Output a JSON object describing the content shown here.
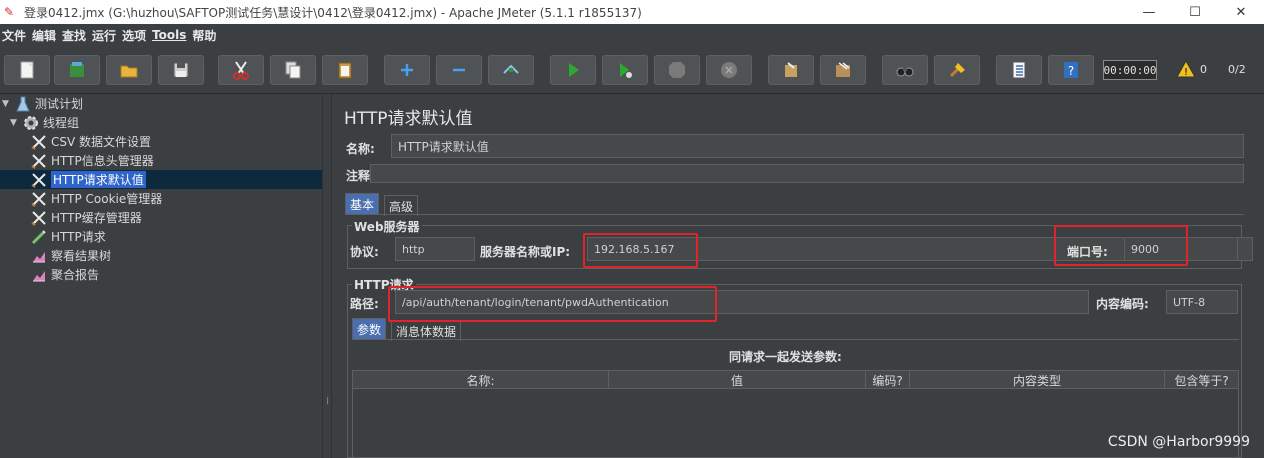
{
  "window": {
    "title": "登录0412.jmx (G:\\huzhou\\SAFTOP测试任务\\慧设计\\0412\\登录0412.jmx) - Apache JMeter (5.1.1 r1855137)",
    "minimize": "—",
    "maximize": "☐",
    "close": "✕"
  },
  "menu": [
    "文件",
    "编辑",
    "查找",
    "运行",
    "选项",
    "Tools",
    "帮助"
  ],
  "toolbar": {
    "timer": "00:00:00",
    "warning_count": "0",
    "threads": "0/2",
    "icons": [
      "new-icon",
      "templates-icon",
      "open-icon",
      "save-icon",
      "cut-icon",
      "copy-icon",
      "paste-icon",
      "expand-icon",
      "collapse-icon",
      "toggle-icon",
      "start-icon",
      "start-no-pause-icon",
      "stop-icon",
      "shutdown-icon",
      "clear-icon",
      "clear-all-icon",
      "search-icon",
      "reset-search-icon",
      "function-helper-icon",
      "help-icon"
    ]
  },
  "tree": [
    {
      "label": "测试计划",
      "icon": "test-plan-icon"
    },
    {
      "label": "线程组",
      "icon": "thread-group-icon"
    },
    {
      "label": "CSV 数据文件设置",
      "icon": "config-icon"
    },
    {
      "label": "HTTP信息头管理器",
      "icon": "config-icon"
    },
    {
      "label": "HTTP请求默认值",
      "icon": "config-icon"
    },
    {
      "label": "HTTP Cookie管理器",
      "icon": "config-icon"
    },
    {
      "label": "HTTP缓存管理器",
      "icon": "config-icon"
    },
    {
      "label": "HTTP请求",
      "icon": "sampler-icon"
    },
    {
      "label": "察看结果树",
      "icon": "listener-icon"
    },
    {
      "label": "聚合报告",
      "icon": "listener-icon"
    }
  ],
  "panel": {
    "title": "HTTP请求默认值",
    "name_label": "名称:",
    "name_value": "HTTP请求默认值",
    "comment_label": "注释:",
    "comment_value": "",
    "tabs": [
      "基本",
      "高级"
    ],
    "web_server": {
      "group_title": "Web服务器",
      "protocol_label": "协议:",
      "protocol_value": "http",
      "server_label": "服务器名称或IP:",
      "server_value": "192.168.5.167",
      "port_label": "端口号:",
      "port_value": "9000"
    },
    "http_request": {
      "group_title": "HTTP请求",
      "path_label": "路径:",
      "path_value": "/api/auth/tenant/login/tenant/pwdAuthentication",
      "encoding_label": "内容编码:",
      "encoding_value": "UTF-8"
    },
    "sub_tabs": [
      "参数",
      "消息体数据"
    ],
    "params_caption": "同请求一起发送参数:",
    "columns": [
      "名称:",
      "值",
      "编码?",
      "内容类型",
      "包含等于?"
    ]
  },
  "watermark": "CSDN @Harbor9999",
  "colors": {
    "highlight": "#e0242b",
    "selection": "#2f65ca",
    "tab_active": "#4b6eaf"
  }
}
